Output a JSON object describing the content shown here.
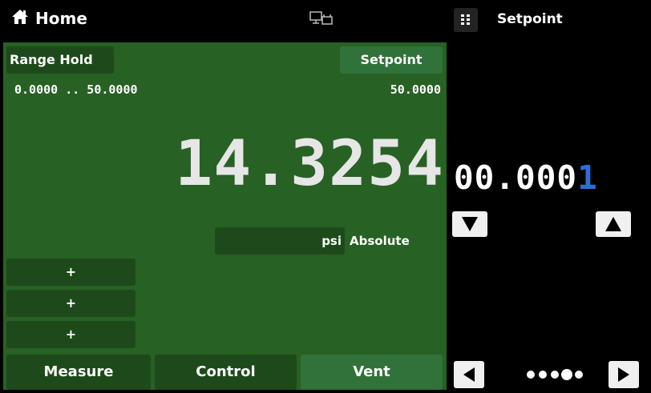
{
  "header": {
    "home_title": "Home",
    "home_icon": "home-icon",
    "network_icon": "network-icon",
    "menu_icon": "menu-grid-icon",
    "setpoint_panel_title": "Setpoint"
  },
  "main": {
    "range_hold_label": "Range Hold",
    "setpoint_button_label": "Setpoint",
    "range_text": "0.0000 .. 50.0000",
    "setpoint_value": "50.0000",
    "reading": "14.3254",
    "unit": "psi",
    "mode": "Absolute",
    "plus_buttons": [
      "+",
      "+",
      "+"
    ],
    "tabs": [
      "Measure",
      "Control",
      "Vent"
    ],
    "active_tab": "Vent",
    "colors": {
      "panel": "#276124",
      "chip": "#1e4a1b",
      "active": "#31723a",
      "cursor_digit": "#2b6fd6"
    }
  },
  "keypad": {
    "entry_prefix": "00.000",
    "entry_cursor_digit": "1",
    "down_icon": "triangle-down-icon",
    "up_icon": "triangle-up-icon",
    "left_icon": "triangle-left-icon",
    "right_icon": "triangle-right-icon",
    "page_dots_total": 5,
    "page_dots_active": 4
  }
}
